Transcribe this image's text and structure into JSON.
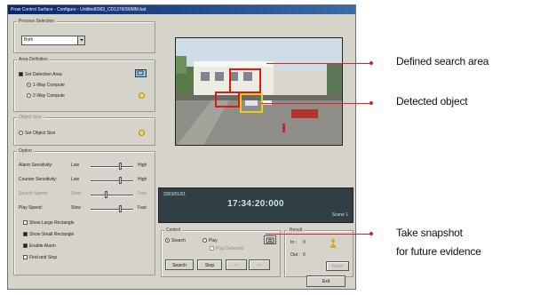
{
  "window": {
    "title": "Prow Control Surface - Configure - Untitled0003_CD1376090MM.bat"
  },
  "process_selection": {
    "group_title": "Process Selection",
    "selected": "Both"
  },
  "area_definition": {
    "group_title": "Area Definition",
    "set_detection_area": "Set Detection Area",
    "one_way": "1-Way Compute",
    "two_way": "2-Way Compute"
  },
  "object_size": {
    "group_title": "Object Size",
    "set_object_size": "Set Object Size"
  },
  "options": {
    "group_title": "Option",
    "rows": [
      {
        "label": "Alarm Sensitivity:",
        "low": "Low",
        "high": "High",
        "level": 0.7,
        "enabled": true
      },
      {
        "label": "Counter Sensitivity:",
        "low": "Low",
        "high": "High",
        "level": 0.7,
        "enabled": true
      },
      {
        "label": "Search Speed:",
        "low": "Slow",
        "high": "Fast",
        "level": 0.35,
        "enabled": false
      },
      {
        "label": "Play Speed:",
        "low": "Slow",
        "high": "Fast",
        "level": 0.7,
        "enabled": true
      }
    ],
    "checkboxes": [
      {
        "label": "Show Large Rectangle",
        "checked": false
      },
      {
        "label": "Show Small Rectangle",
        "checked": true
      },
      {
        "label": "Enable Alarm",
        "checked": true
      },
      {
        "label": "Find and Stop",
        "checked": false
      }
    ]
  },
  "display": {
    "date": "2003/01/01",
    "time": "17:34:20:000",
    "scene": "Scene 1"
  },
  "control": {
    "group_title": "Control",
    "mode_search": "Search",
    "mode_play": "Play",
    "play_sub": "Play Detected",
    "buttons": {
      "search": "Search",
      "stop": "Stop",
      "prev": "<<",
      "next": ">>"
    }
  },
  "result": {
    "group_title": "Result",
    "in_label": "In :",
    "in_value": "0",
    "out_label": "Out :",
    "out_value": "0",
    "reset": "Reset"
  },
  "exit_button": "Exit",
  "annotations": {
    "search_area": "Defined search area",
    "detected": "Detected object",
    "snapshot_line1": "Take snapshot",
    "snapshot_line2": "for future evidence"
  },
  "colors": {
    "annotation": "#d3282a",
    "title_bar": "#0a246a",
    "search_area_box": "#e01818",
    "detected_box": "#e8d020"
  }
}
